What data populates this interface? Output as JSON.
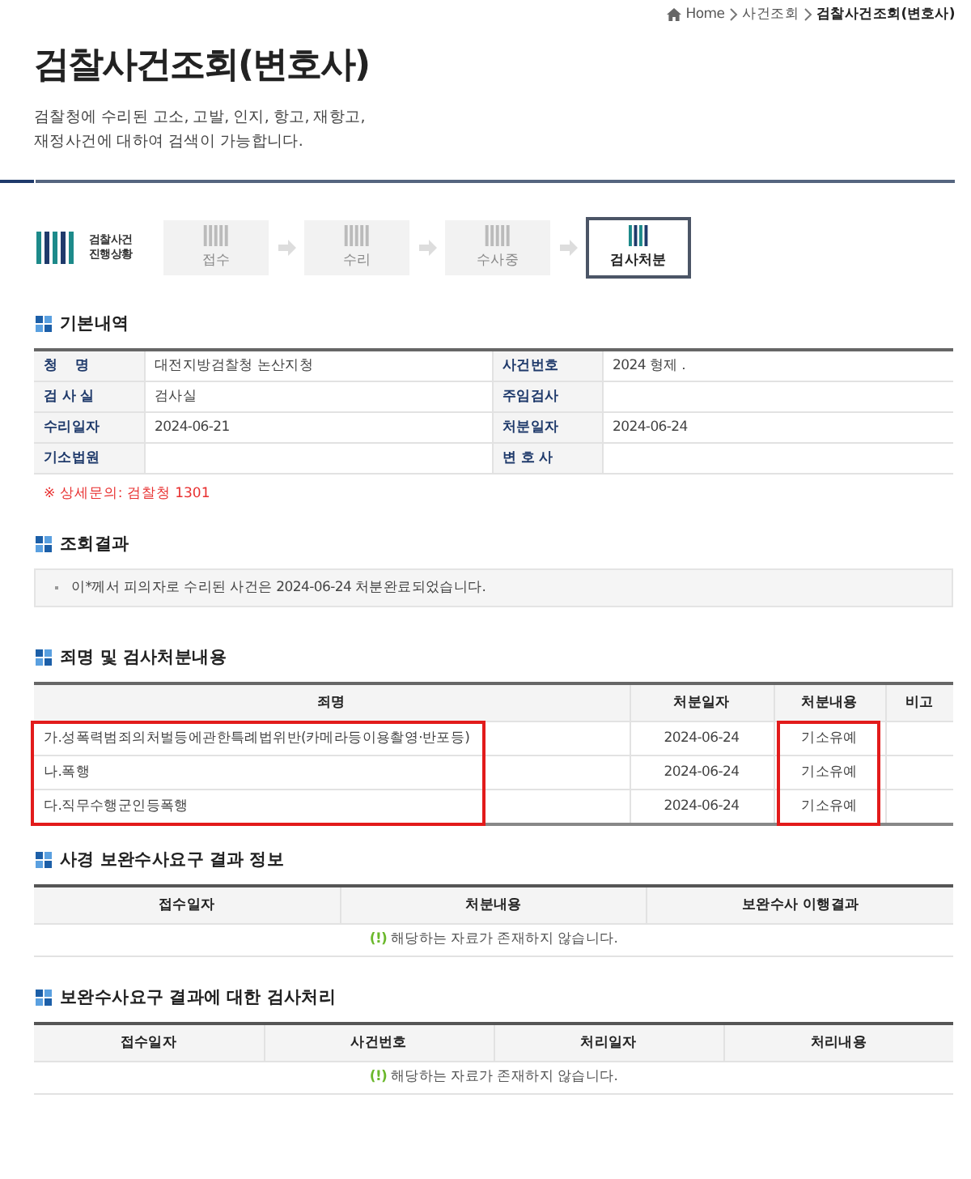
{
  "breadcrumb": [
    {
      "label": "Home",
      "kind": "home"
    },
    {
      "label": "사건조회",
      "kind": "link"
    },
    {
      "label": "검찰사건조회(변호사)",
      "kind": "current"
    }
  ],
  "title": "검찰사건조회(변호사)",
  "description": [
    "검찰청에 수리된 고소, 고발, 인지, 항고, 재항고,",
    "재정사건에 대하여 검색이 가능합니다."
  ],
  "progress": {
    "logo_text": [
      "검찰사건",
      "진행상황"
    ],
    "steps": [
      {
        "label": "접수",
        "selected": false
      },
      {
        "label": "수리",
        "selected": false
      },
      {
        "label": "수사중",
        "selected": false
      },
      {
        "label": "검사처분",
        "selected": true
      }
    ]
  },
  "basic_info": {
    "title": "기본내역",
    "rows": [
      [
        {
          "label": "청    명",
          "value": "대전지방검찰청 논산지청"
        },
        {
          "label": "사건번호",
          "value": "2024 형제 ."
        }
      ],
      [
        {
          "label": "검 사 실",
          "value": "검사실"
        },
        {
          "label": "주임검사"
        }
      ],
      [
        {
          "label": "수리일자",
          "value": "2024-06-21"
        },
        {
          "label": "처분일자",
          "value": "2024-06-24"
        }
      ],
      [
        {
          "label": "기소법원"
        },
        {
          "label": "변 호 사"
        }
      ]
    ],
    "note": "※ 상세문의: 검찰청 1301"
  },
  "result": {
    "title": "조회결과",
    "message": "이*께서 피의자로 수리된 사건은 2024-06-24 처분완료되었습니다."
  },
  "charges": {
    "title": "죄명 및 검사처분내용",
    "columns": [
      {
        "label": "죄명",
        "highlighted": true
      },
      {
        "label": "처분일자",
        "highlighted": false
      },
      {
        "label": "처분내용",
        "highlighted": true
      },
      {
        "label": "비고",
        "highlighted": false
      }
    ],
    "rows": [
      [
        "가.성폭력범죄의처벌등에관한특례법위반(카메라등이용촬영·반포등)",
        "2024-06-24",
        "기소유예"
      ],
      [
        "나.폭행",
        "2024-06-24",
        "기소유예"
      ],
      [
        "다.직무수행군인등폭행",
        "2024-06-24",
        "기소유예"
      ]
    ]
  },
  "police_request": {
    "title": "사경 보완수사요구 결과 정보",
    "columns": [
      {
        "label": "접수일자"
      },
      {
        "label": "처분내용"
      },
      {
        "label": "보완수사 이행결과"
      }
    ],
    "empty_mark": "(!)",
    "empty_text": "해당하는 자료가 존재하지 않습니다."
  },
  "prosecutor_handling": {
    "title": "보완수사요구 결과에 대한 검사처리",
    "columns": [
      {
        "label": "접수일자"
      },
      {
        "label": "사건번호"
      },
      {
        "label": "처리일자"
      },
      {
        "label": "처리내용"
      }
    ],
    "empty_mark": "(!)",
    "empty_text": "해당하는 자료가 존재하지 않습니다."
  }
}
